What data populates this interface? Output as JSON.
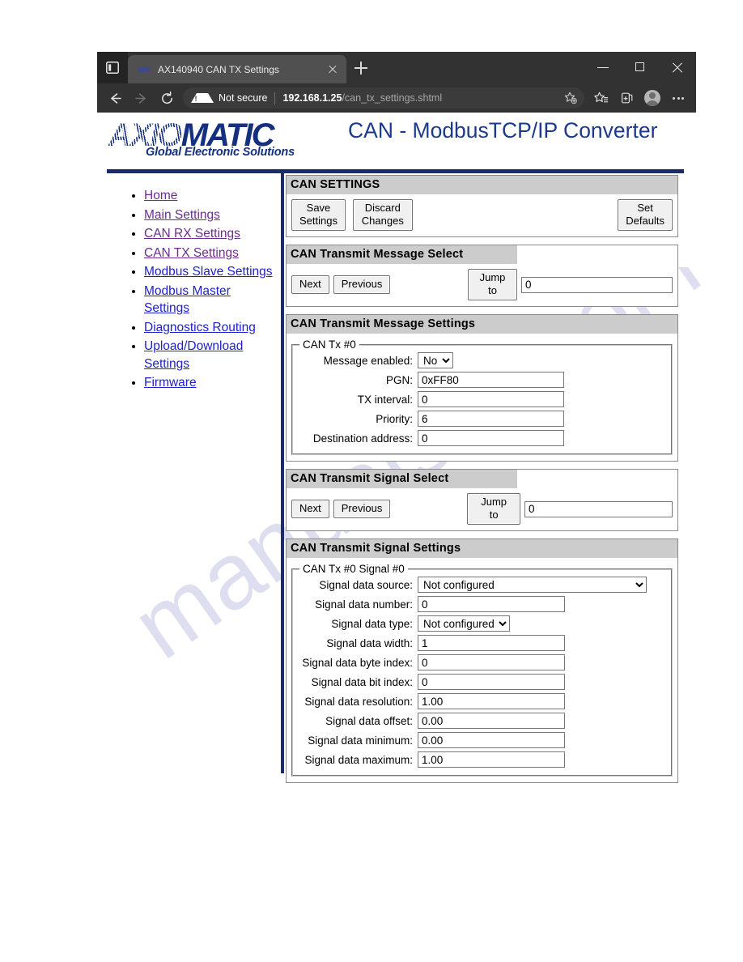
{
  "browser": {
    "tab": {
      "title": "AX140940 CAN TX Settings",
      "favicon": "axiomatic-favicon-icon"
    },
    "new_tab_label": "+",
    "security_label": "Not secure",
    "url_host": "192.168.1.25",
    "url_path": "/can_tx_settings.shtml",
    "icons": {
      "sidebar": "tab-sidebar-icon",
      "back": "back-arrow-icon",
      "forward": "forward-arrow-icon",
      "reload": "reload-icon",
      "warning": "warning-triangle-icon",
      "add_favorite": "add-favorite-star-icon",
      "favorites": "favorites-star-list-icon",
      "collections": "collections-icon",
      "profile": "profile-avatar-icon",
      "settings_more": "more-options-icon",
      "minimize": "minimize-icon",
      "maximize": "maximize-icon",
      "close": "close-window-icon"
    }
  },
  "header": {
    "logo_part1": "AXIO",
    "logo_part2": "MATIC",
    "logo_tagline": "Global Electronic Solutions",
    "product_title": "CAN - ModbusTCP/IP Converter"
  },
  "watermark": "manualslib.com",
  "colors": {
    "brand_blue": "#15307f",
    "rule_navy": "#1b2a6b",
    "panel_header_gray": "#cccccc",
    "link_visited": "#6c2d8f",
    "link_unvisited": "#2020cc"
  },
  "sidebar": {
    "items": [
      {
        "label": "Home",
        "state": "visited"
      },
      {
        "label": "Main Settings",
        "state": "visited"
      },
      {
        "label": "CAN RX Settings",
        "state": "visited"
      },
      {
        "label": "CAN TX Settings",
        "state": "visited"
      },
      {
        "label": "Modbus Slave Settings",
        "state": "unvisited"
      },
      {
        "label": "Modbus Master Settings",
        "state": "unvisited"
      },
      {
        "label": "Diagnostics Routing",
        "state": "unvisited"
      },
      {
        "label": "Upload/Download Settings",
        "state": "unvisited"
      },
      {
        "label": "Firmware",
        "state": "unvisited"
      }
    ]
  },
  "can_settings": {
    "title": "CAN SETTINGS",
    "save_label": "Save Settings",
    "discard_label": "Discard Changes",
    "defaults_label": "Set Defaults"
  },
  "msg_select": {
    "title": "CAN Transmit Message Select",
    "next_label": "Next",
    "previous_label": "Previous",
    "jump_label": "Jump to",
    "jump_value": "0"
  },
  "msg_settings": {
    "title": "CAN Transmit Message Settings",
    "legend": "CAN Tx #0",
    "fields": [
      {
        "label": "Message enabled:",
        "value": "No",
        "type": "select"
      },
      {
        "label": "PGN:",
        "value": "0xFF80",
        "type": "text"
      },
      {
        "label": "TX interval:",
        "value": "0",
        "type": "text"
      },
      {
        "label": "Priority:",
        "value": "6",
        "type": "text"
      },
      {
        "label": "Destination address:",
        "value": "0",
        "type": "text"
      }
    ]
  },
  "sig_select": {
    "title": "CAN Transmit Signal Select",
    "next_label": "Next",
    "previous_label": "Previous",
    "jump_label": "Jump to",
    "jump_value": "0"
  },
  "sig_settings": {
    "title": "CAN Transmit Signal Settings",
    "legend": "CAN Tx #0 Signal #0",
    "fields": [
      {
        "label": "Signal data source:",
        "value": "Not configured",
        "type": "select-wide"
      },
      {
        "label": "Signal data number:",
        "value": "0",
        "type": "text"
      },
      {
        "label": "Signal data type:",
        "value": "Not configured",
        "type": "select"
      },
      {
        "label": "Signal data width:",
        "value": "1",
        "type": "text"
      },
      {
        "label": "Signal data byte index:",
        "value": "0",
        "type": "text"
      },
      {
        "label": "Signal data bit index:",
        "value": "0",
        "type": "text"
      },
      {
        "label": "Signal data resolution:",
        "value": "1.00",
        "type": "text"
      },
      {
        "label": "Signal data offset:",
        "value": "0.00",
        "type": "text"
      },
      {
        "label": "Signal data minimum:",
        "value": "0.00",
        "type": "text"
      },
      {
        "label": "Signal data maximum:",
        "value": "1.00",
        "type": "text"
      }
    ]
  }
}
